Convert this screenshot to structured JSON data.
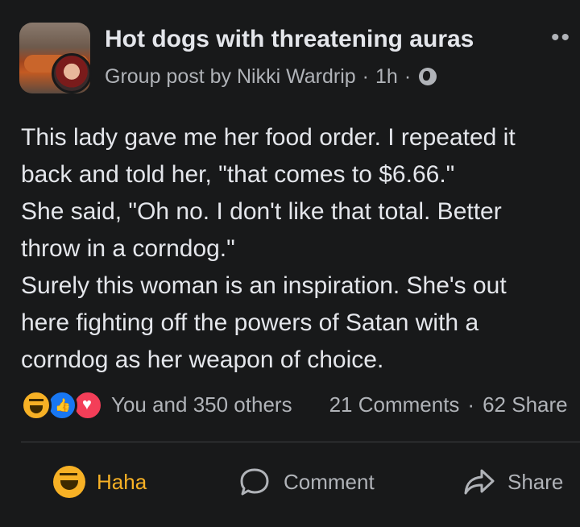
{
  "header": {
    "title": "Hot dogs with threatening auras",
    "post_type": "Group post by Nikki Wardrip",
    "time": "1h",
    "separator": "·"
  },
  "post": {
    "lines": [
      "This lady gave me her food order. I repeated it",
      "back and told her, \"that comes to $6.66.\"",
      "She said, \"Oh no. I don't like that total. Better",
      "throw in a corndog.\"",
      "Surely this woman is an inspiration. She's out",
      "here fighting off the powers of Satan with a",
      "corndog as her weapon of choice."
    ]
  },
  "reactions": {
    "icons": [
      "haha-icon",
      "like-icon",
      "love-icon"
    ],
    "count_text": "You and 350 others",
    "comments": "21 Comments",
    "shares": "62 Share",
    "separator": "·"
  },
  "actions": {
    "haha_label": "Haha",
    "comment_label": "Comment",
    "share_label": "Share"
  },
  "colors": {
    "background": "#18191a",
    "text": "#e4e6eb",
    "secondary_text": "#b0b3b8",
    "haha_accent": "#f7b125"
  }
}
